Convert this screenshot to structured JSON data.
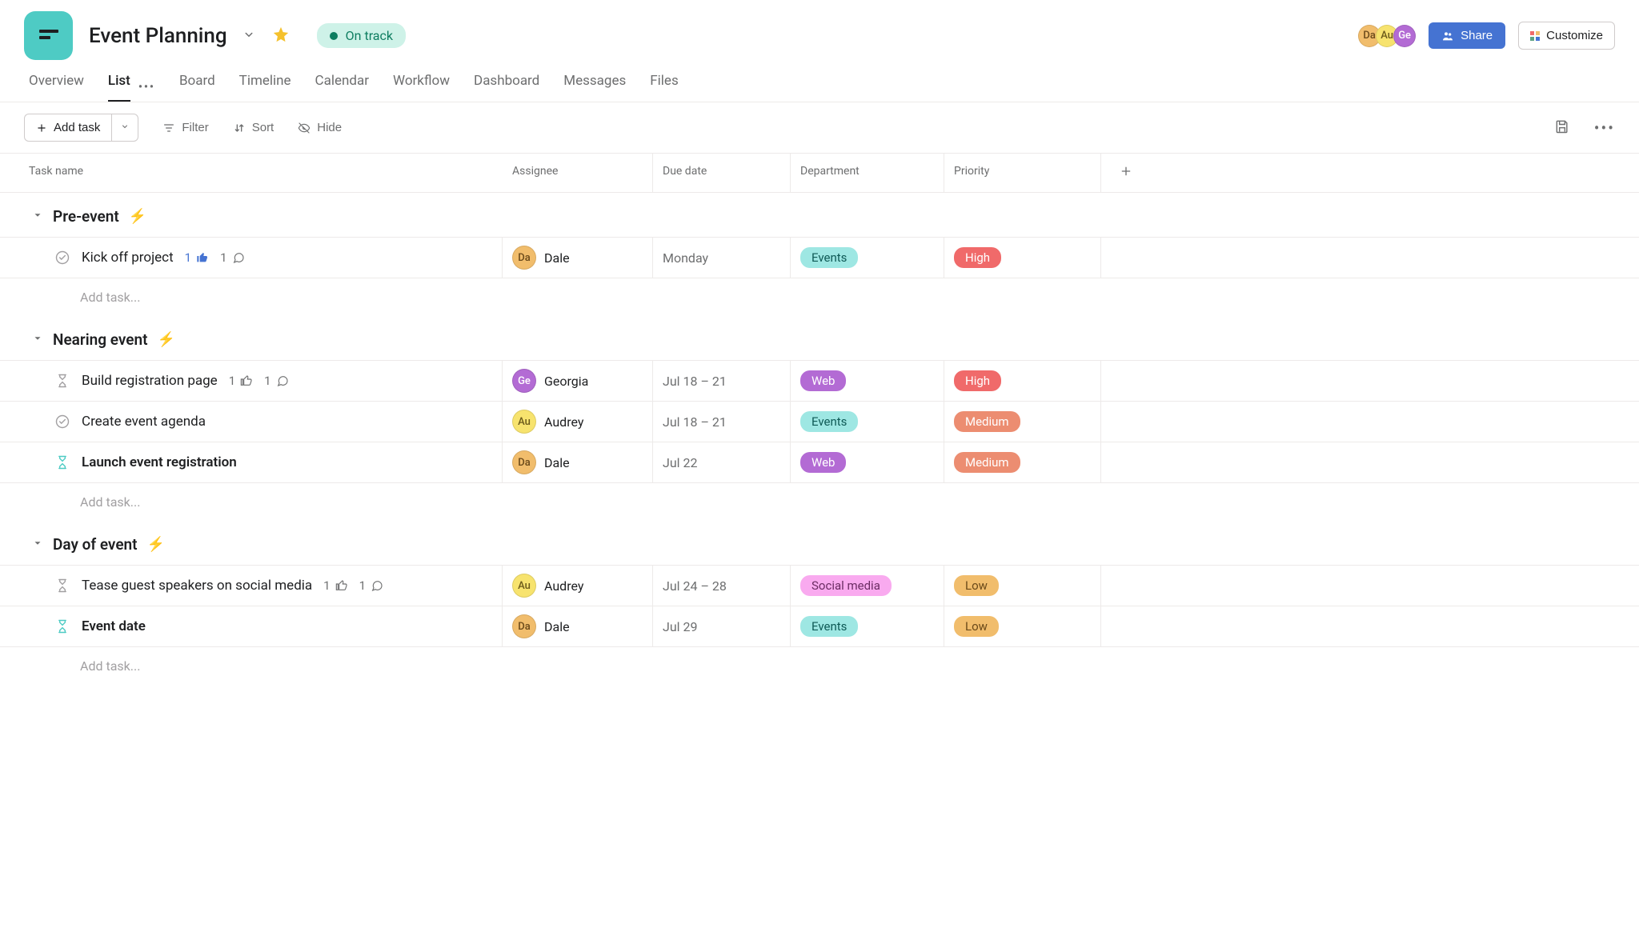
{
  "header": {
    "title": "Event Planning",
    "status": "On track",
    "share": "Share",
    "customize": "Customize",
    "members": [
      {
        "initials": "Da",
        "cls": "av-da"
      },
      {
        "initials": "Au",
        "cls": "av-au"
      },
      {
        "initials": "Ge",
        "cls": "av-ge"
      }
    ]
  },
  "tabs": {
    "overview": "Overview",
    "list": "List",
    "board": "Board",
    "timeline": "Timeline",
    "calendar": "Calendar",
    "workflow": "Workflow",
    "dashboard": "Dashboard",
    "messages": "Messages",
    "files": "Files"
  },
  "toolbar": {
    "add_task": "Add task",
    "filter": "Filter",
    "sort": "Sort",
    "hide": "Hide"
  },
  "columns": {
    "task": "Task name",
    "assignee": "Assignee",
    "due": "Due date",
    "department": "Department",
    "priority": "Priority"
  },
  "add_task_placeholder": "Add task...",
  "sections": {
    "s0": {
      "title": "Pre-event",
      "tasks": {
        "t0": {
          "name": "Kick off project",
          "likes": "1",
          "comments": "1",
          "assignee_initials": "Da",
          "assignee": "Dale",
          "due": "Monday",
          "dept": "Events",
          "priority": "High"
        }
      }
    },
    "s1": {
      "title": "Nearing event",
      "tasks": {
        "t0": {
          "name": "Build registration page",
          "likes": "1",
          "comments": "1",
          "assignee_initials": "Ge",
          "assignee": "Georgia",
          "due": "Jul 18 – 21",
          "dept": "Web",
          "priority": "High"
        },
        "t1": {
          "name": "Create event agenda",
          "assignee_initials": "Au",
          "assignee": "Audrey",
          "due": "Jul 18 – 21",
          "dept": "Events",
          "priority": "Medium"
        },
        "t2": {
          "name": "Launch event registration",
          "assignee_initials": "Da",
          "assignee": "Dale",
          "due": "Jul 22",
          "dept": "Web",
          "priority": "Medium"
        }
      }
    },
    "s2": {
      "title": "Day of event",
      "tasks": {
        "t0": {
          "name": "Tease guest speakers on social media",
          "likes": "1",
          "comments": "1",
          "assignee_initials": "Au",
          "assignee": "Audrey",
          "due": "Jul 24 – 28",
          "dept": "Social media",
          "priority": "Low"
        },
        "t1": {
          "name": "Event date",
          "assignee_initials": "Da",
          "assignee": "Dale",
          "due": "Jul 29",
          "dept": "Events",
          "priority": "Low"
        }
      }
    }
  }
}
